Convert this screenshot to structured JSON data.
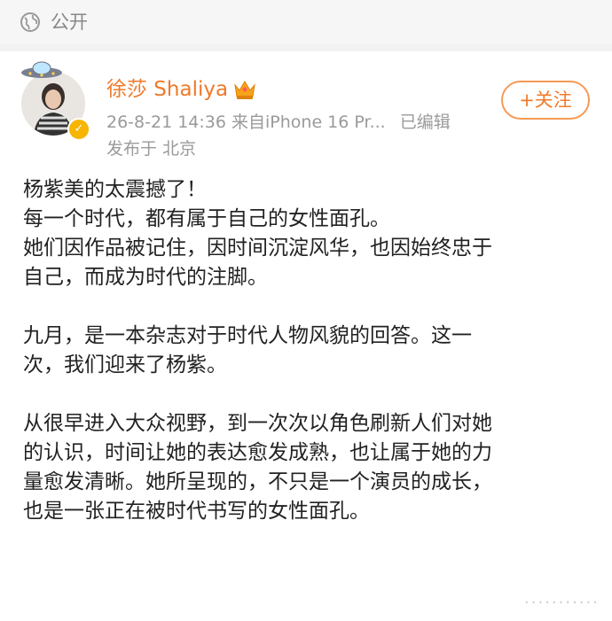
{
  "visibility": {
    "label": "公开",
    "icon": "globe-icon"
  },
  "author": {
    "name": "徐莎 Shaliya",
    "badge_icon": "crown-icon",
    "verified_icon": "verified-badge-icon"
  },
  "meta": {
    "datetime": "26-8-21 14:36",
    "source": "来自iPhone 16 Pr...",
    "edited": "已编辑",
    "location": "发布于 北京"
  },
  "follow_button": {
    "label": "+关注"
  },
  "post": {
    "paragraphs": [
      [
        "杨紫美的太震撼了！",
        "每一个时代，都有属于自己的女性面孔。",
        "她们因作品被记住，因时间沉淀风华，也因始终忠于",
        "自己，而成为时代的注脚。"
      ],
      [
        "九月，是一本杂志对于时代人物风貌的回答。这一",
        "次，我们迎来了杨紫。"
      ],
      [
        "从很早进入大众视野，到一次次以角色刷新人们对她",
        "的认识，时间让她的表达愈发成熟，也让属于她的力",
        "量愈发清晰。她所呈现的，不只是一个演员的成长，",
        "也是一张正在被时代书写的女性面孔。"
      ]
    ]
  },
  "colors": {
    "accent": "#ef7a2a",
    "meta_gray": "#9a9a9a",
    "text": "#222222"
  }
}
